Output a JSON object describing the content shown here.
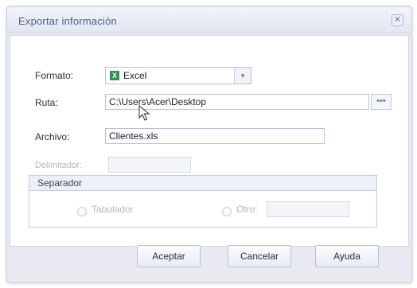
{
  "dialog": {
    "title": "Exportar información",
    "close_glyph": "✕"
  },
  "form": {
    "formato": {
      "label": "Formato:",
      "value": "Excel",
      "icon": "excel-icon",
      "arrow_glyph": "▾"
    },
    "ruta": {
      "label": "Ruta:",
      "value": "C:\\Users\\Acer\\Desktop",
      "browse_label": "•••"
    },
    "archivo": {
      "label": "Archivo:",
      "value": "Clientes.xls"
    },
    "delimitador": {
      "label": "Delimitador:",
      "value": ""
    }
  },
  "separador": {
    "title": "Separador",
    "tabulador_label": "Tabulador",
    "otro_label": "Otro:",
    "otro_value": ""
  },
  "buttons": {
    "aceptar": "Aceptar",
    "cancelar": "Cancelar",
    "ayuda": "Ayuda"
  },
  "colors": {
    "title_text": "#4d5f8f",
    "dialog_bg": "#e9eaf1",
    "excel_green": "#3b8a4d"
  }
}
